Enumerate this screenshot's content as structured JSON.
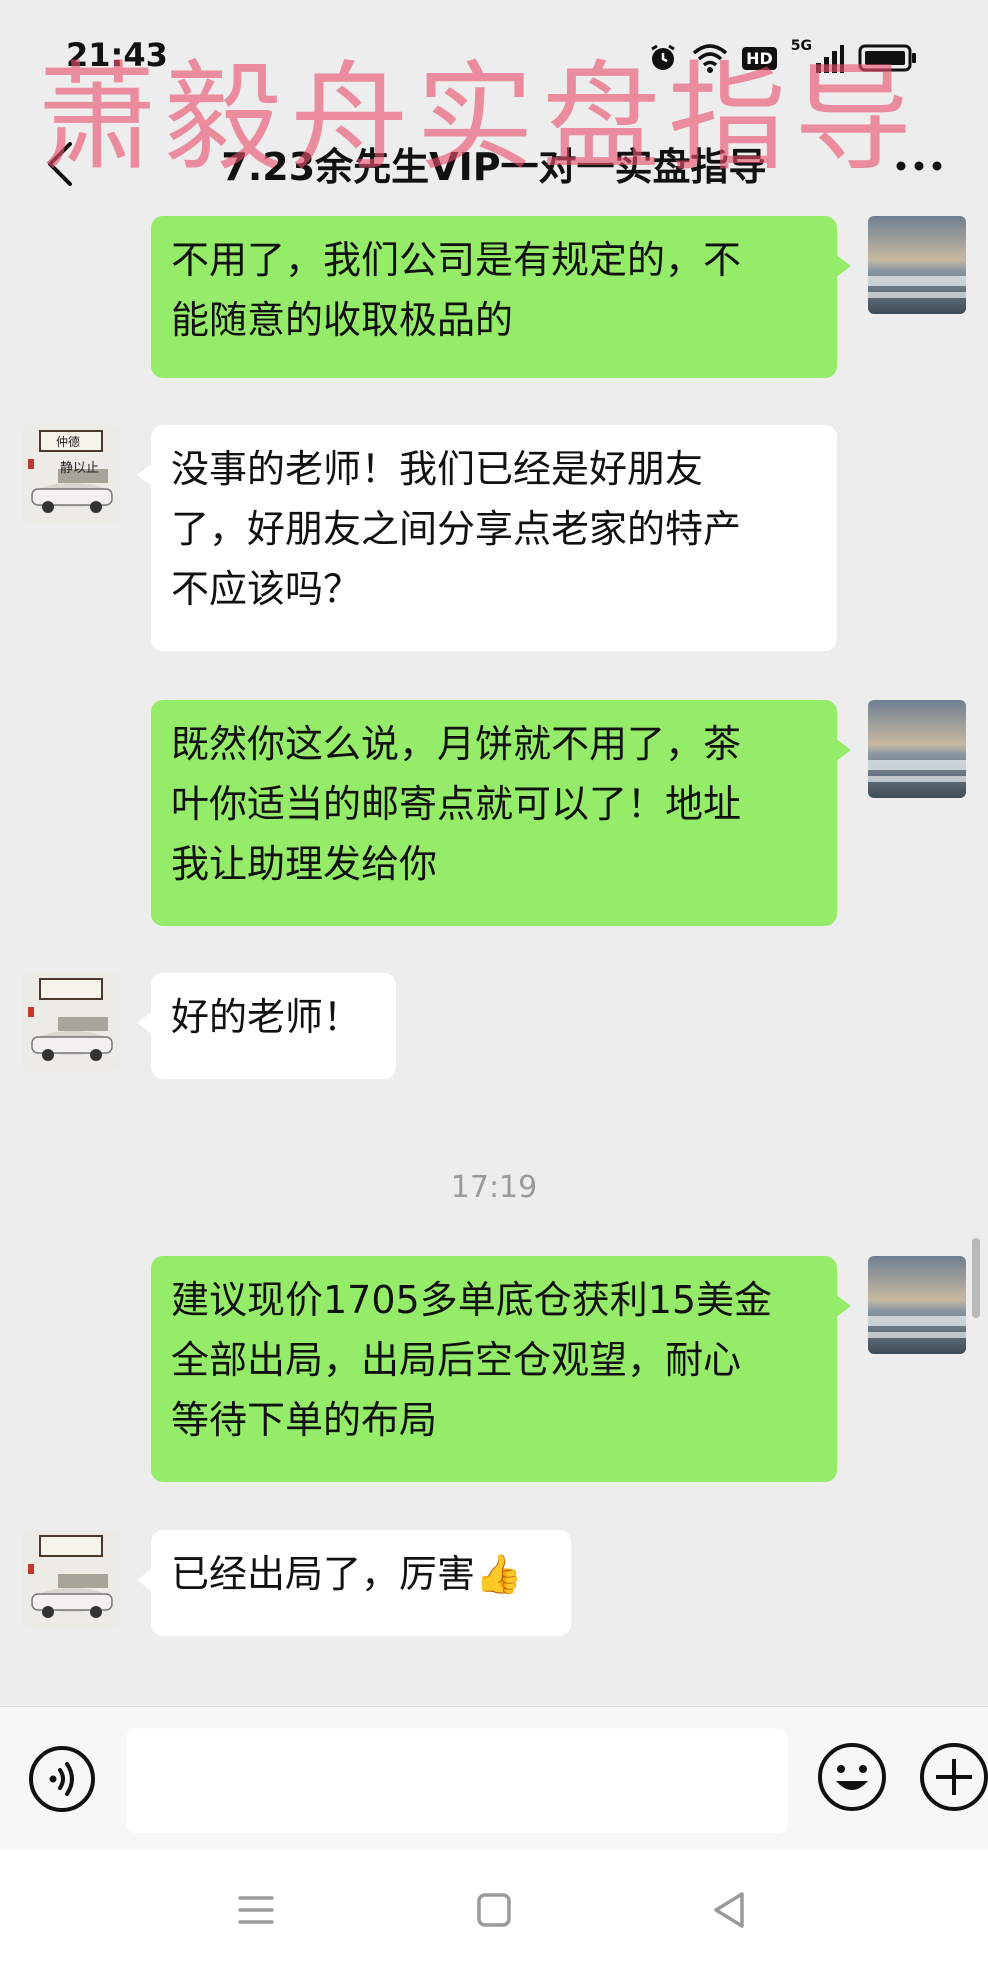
{
  "status_bar": {
    "time": "21:43",
    "network": "5G",
    "hd": "HD"
  },
  "watermark": "萧毅舟实盘指导",
  "nav": {
    "title": "7.23余先生VIP一对一实盘指导"
  },
  "messages": [
    {
      "side": "right",
      "text": "不用了，我们公司是有规定的，不能随意的收取极品的",
      "lines": [
        "不用了，我们公司是有规定的，不",
        "能随意的收取极品的"
      ]
    },
    {
      "side": "left",
      "text": "没事的老师！我们已经是好朋友了，好朋友之间分享点老家的特产不应该吗？",
      "lines": [
        "没事的老师！我们已经是好朋友",
        "了，好朋友之间分享点老家的特产",
        "不应该吗？"
      ]
    },
    {
      "side": "right",
      "text": "既然你这么说，月饼就不用了，茶叶你适当的邮寄点就可以了！地址我让助理发给你",
      "lines": [
        "既然你这么说，月饼就不用了，茶",
        "叶你适当的邮寄点就可以了！地址",
        "我让助理发给你"
      ]
    },
    {
      "side": "left",
      "text": "好的老师！",
      "lines": [
        "好的老师！"
      ]
    },
    {
      "side": "right",
      "text": "建议现价1705多单底仓获利15美金全部出局，出局后空仓观望，耐心等待下单的布局",
      "lines": [
        "建议现价1705多单底仓获利15美金",
        "全部出局，出局后空仓观望，耐心",
        "等待下单的布局"
      ]
    },
    {
      "side": "left",
      "text": "已经出局了，厉害👍",
      "lines": [
        "已经出局了，厉害👍"
      ]
    }
  ],
  "timestamp": "17:19",
  "avatar_left_text": {
    "top": "仲德",
    "bottom": "静以止"
  },
  "colors": {
    "background": "#ededed",
    "bubble_self": "#95ec69",
    "bubble_other": "#ffffff",
    "watermark": "#e8506e"
  },
  "icons": {
    "back": "chevron-left-icon",
    "more": "more-dots-icon",
    "voice": "voice-icon",
    "emoji": "emoji-icon",
    "plus": "plus-icon",
    "menu": "menu-icon",
    "home": "home-icon",
    "back_nav": "back-triangle-icon"
  }
}
